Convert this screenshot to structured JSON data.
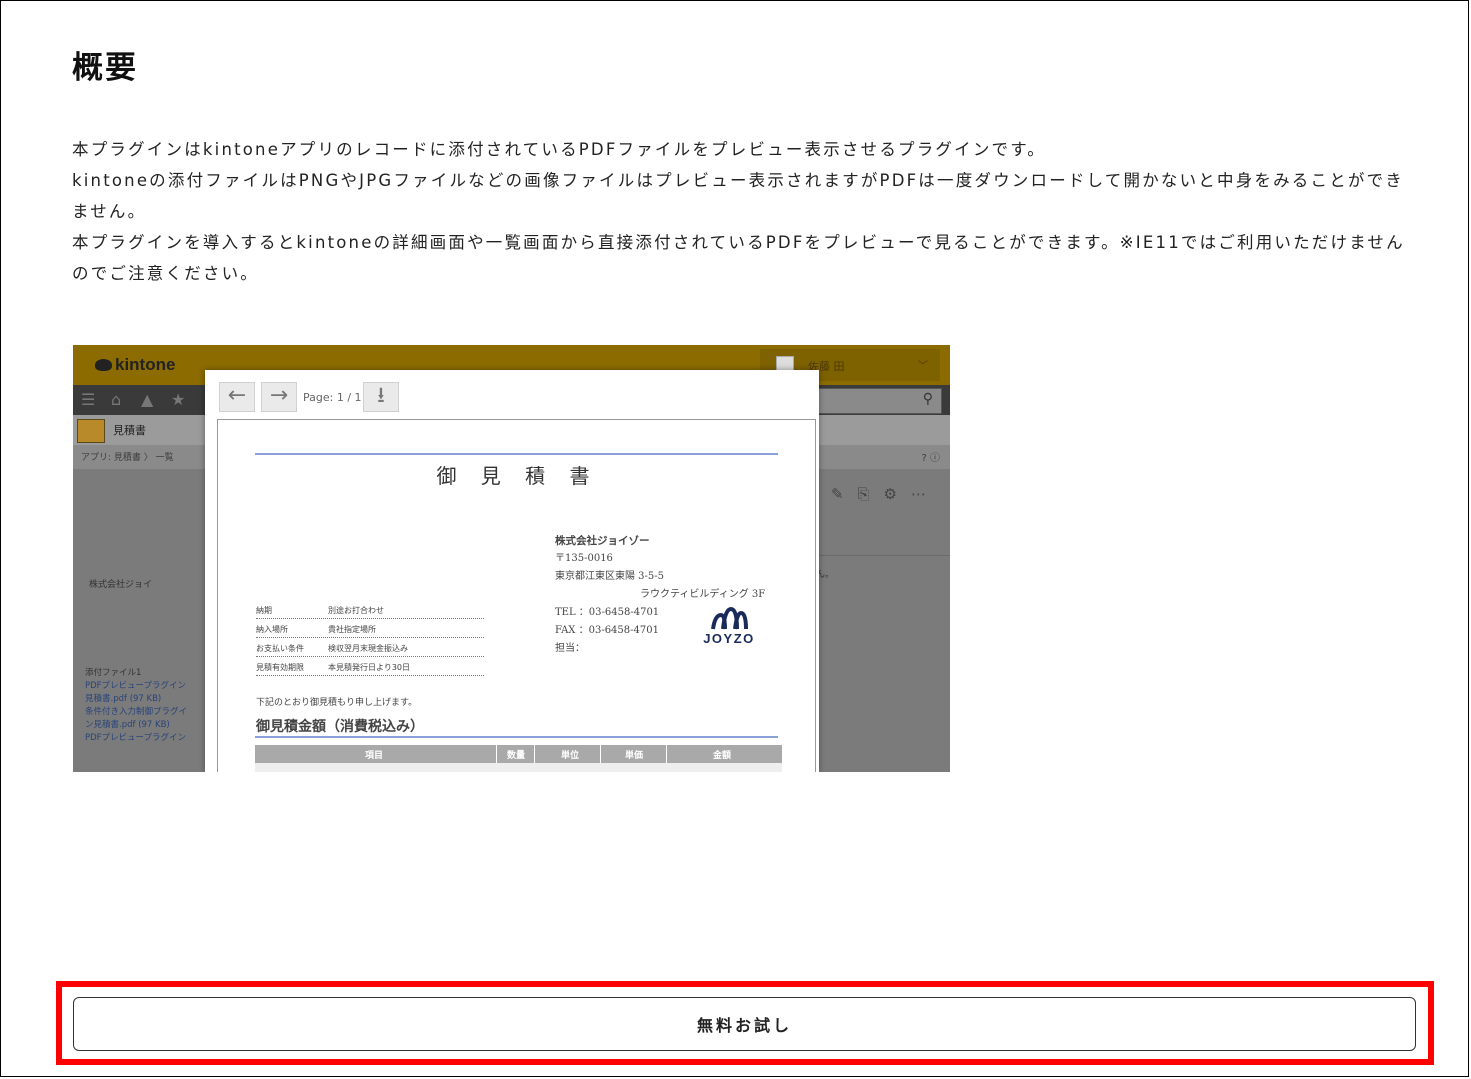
{
  "section": {
    "title": "概要",
    "description": [
      "本プラグインはkintoneアプリのレコードに添付されているPDFファイルをプレビュー表示させるプラグインです。",
      "kintoneの添付ファイルはPNGやJPGファイルなどの画像ファイルはプレビュー表示されますがPDFは一度ダウンロードして開かないと中身をみることができません。",
      "本プラグインを導入するとkintoneの詳細画面や一覧画面から直接添付されているPDFをプレビューで見ることができます。※IE11ではご利用いただけませんのでご注意ください。"
    ]
  },
  "screenshot": {
    "kintone_logo": "kintone",
    "user_name": "佐藤 田",
    "app_name": "見積書",
    "breadcrumb": "アプリ: 見積書 〉 一覧",
    "customer_label": "株式会社ジョイ",
    "attachments_label": "添付ファイル1",
    "attachment_links": [
      "PDFプレビュープラグイン",
      "見積書.pdf (97 KB)",
      "条件付き入力制御プラグイ",
      "ン見積書.pdf (97 KB)",
      "PDFプレビュープラグイン"
    ],
    "right_note": "ん。",
    "preview": {
      "page_indicator": "Page: 1 / 1",
      "back_icon": "arrow-left-icon",
      "forward_icon": "arrow-right-icon",
      "download_icon": "download-icon",
      "document": {
        "title": "御 見 積 書",
        "company_name": "株式会社ジョイゾー",
        "postal": "〒135-0016",
        "address1": "東京都江東区東陽 3-5-5",
        "address2": "ラウクティビルディング 3F",
        "tel": "TEL ：03-6458-4701",
        "fax": "FAX ：03-6458-4701",
        "staff": "担当：",
        "logo_text": "JOYZO",
        "terms": [
          {
            "key": "納期",
            "value": "別途お打合わせ"
          },
          {
            "key": "納入場所",
            "value": "貴社指定場所"
          },
          {
            "key": "お支払い条件",
            "value": "検収翌月末現金振込み"
          },
          {
            "key": "見積有効期限",
            "value": "本見積発行日より30日"
          }
        ],
        "note": "下記のとおり御見積もり申し上げます。",
        "amount_label": "御見積金額（消費税込み）",
        "table_headers": [
          "項目",
          "数量",
          "単位",
          "単価",
          "金額"
        ]
      }
    }
  },
  "cta": {
    "label": "無料お試し",
    "highlight_color": "#ff0000"
  }
}
